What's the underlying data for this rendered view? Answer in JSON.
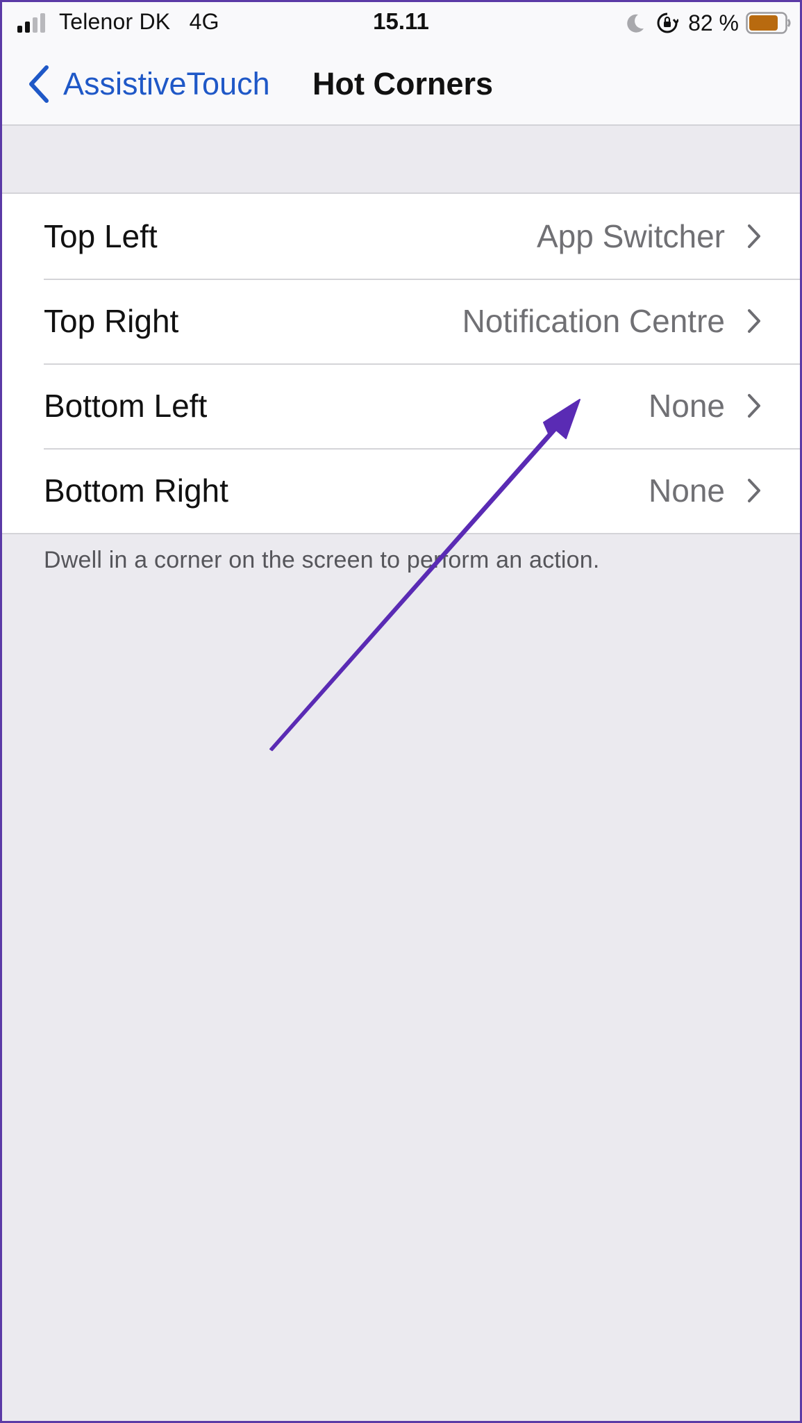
{
  "status_bar": {
    "carrier": "Telenor DK",
    "network": "4G",
    "time": "15.11",
    "battery_percent": "82 %",
    "battery_level": 0.82,
    "battery_color": "#b86a0f",
    "icons": [
      "signal-icon",
      "moon-icon",
      "lock-rotation-icon",
      "battery-icon"
    ]
  },
  "nav": {
    "back_label": "AssistiveTouch",
    "title": "Hot Corners",
    "accent_color": "#1f58c7"
  },
  "corners": [
    {
      "label": "Top Left",
      "value": "App Switcher"
    },
    {
      "label": "Top Right",
      "value": "Notification Centre"
    },
    {
      "label": "Bottom Left",
      "value": "None"
    },
    {
      "label": "Bottom Right",
      "value": "None"
    }
  ],
  "footer": {
    "note": "Dwell in a corner on the screen to perform an action."
  },
  "annotation": {
    "icon": "arrow-icon",
    "color": "#5a2bb4"
  }
}
